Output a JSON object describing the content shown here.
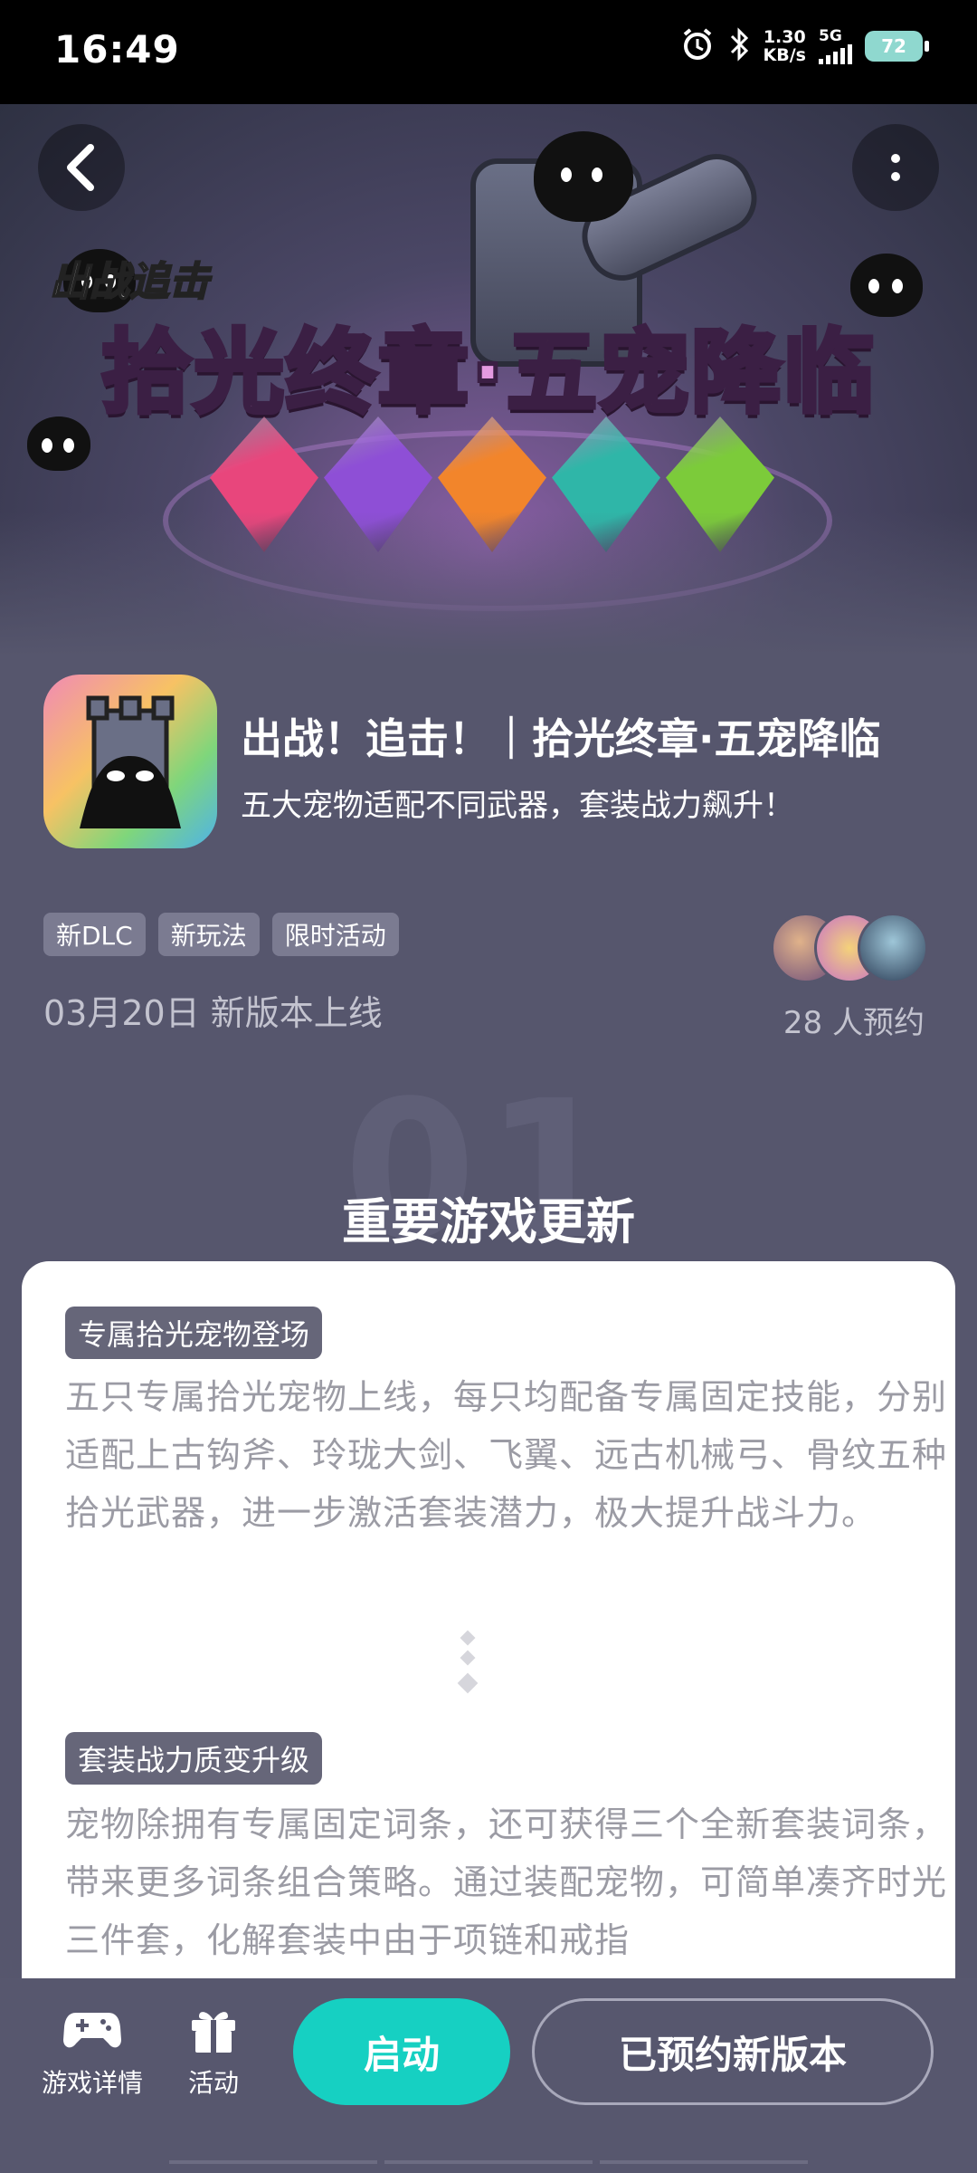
{
  "status_bar": {
    "time": "16:49",
    "net_speed_value": "1.30",
    "net_speed_unit": "KB/s",
    "network": "5G",
    "battery": "72",
    "icons": [
      "alarm-icon",
      "bluetooth-icon",
      "signal-icon",
      "battery-icon"
    ]
  },
  "banner": {
    "logo_text": "出战追击",
    "title_part1": "拾光终章·",
    "title_part2": "五宠降临",
    "gem_colors": [
      "#e8467c",
      "#8e4fd6",
      "#f2852b",
      "#2fb6a8",
      "#7ccb3a"
    ]
  },
  "app": {
    "title": "出战！追击！｜拾光终章·五宠降临",
    "subtitle": "五大宠物适配不同武器，套装战力飙升！",
    "tags": [
      "新DLC",
      "新玩法",
      "限时活动"
    ],
    "release_date": "03月20日 新版本上线",
    "reserve_count": "28 人预约"
  },
  "section": {
    "number": "01",
    "heading": "重要游戏更新"
  },
  "updates": [
    {
      "tag": "专属拾光宠物登场",
      "text": "五只专属拾光宠物上线，每只均配备专属固定技能，分别适配上古钩斧、玲珑大剑、飞翼、远古机械弓、骨纹五种拾光武器，进一步激活套装潜力，极大提升战斗力。"
    },
    {
      "tag": "套装战力质变升级",
      "text": "宠物除拥有专属固定词条，还可获得三个全新套装词条，带来更多词条组合策略。通过装配宠物，可简单凑齐时光三件套，化解套装中由于项链和戒指"
    }
  ],
  "bottom_bar": {
    "game_details": "游戏详情",
    "activity": "活动",
    "start": "启动",
    "reserved": "已预约新版本"
  },
  "colors": {
    "page_bg": "#56566d",
    "accent": "#16d0c2",
    "tag_bg": "#7b7b91"
  }
}
